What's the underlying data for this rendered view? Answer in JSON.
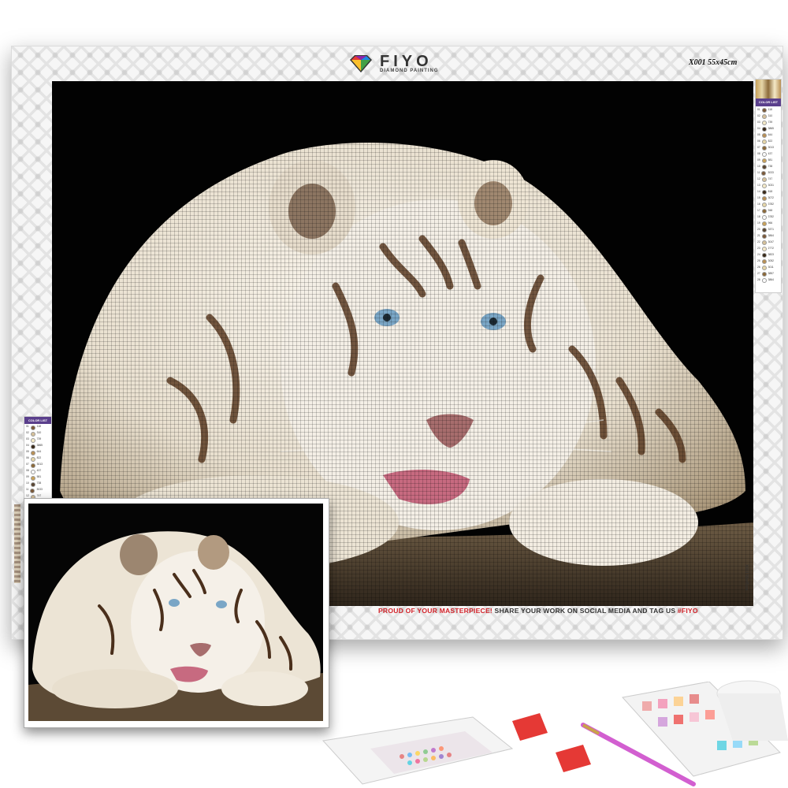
{
  "brand": {
    "name": "FIYO",
    "subtitle": "DIAMOND PAINTING"
  },
  "canvas": {
    "size_label": "X001 55x45cm",
    "side_code": "X001 55x45cm",
    "legend_title": "COLOR LIST"
  },
  "footer": {
    "highlight": "PROUD OF YOUR MASTERPIECE!",
    "message": " SHARE YOUR WORK ON SOCIAL MEDIA AND TAG US ",
    "hashtag": "#FIYO"
  },
  "legend_right_rows": [
    [
      "01",
      "118"
    ],
    [
      "02",
      "310"
    ],
    [
      "03",
      "739"
    ],
    [
      "04",
      "3865"
    ],
    [
      "05",
      "644"
    ],
    [
      "06",
      "822"
    ],
    [
      "07",
      "3013"
    ],
    [
      "08",
      "437"
    ],
    [
      "09",
      "581"
    ],
    [
      "10",
      "738"
    ],
    [
      "11",
      "3033"
    ],
    [
      "12",
      "747"
    ],
    [
      "13",
      "3031"
    ],
    [
      "14",
      "818"
    ],
    [
      "15",
      "3072"
    ],
    [
      "16",
      "3782"
    ],
    [
      "17",
      "948"
    ],
    [
      "18",
      "3782"
    ],
    [
      "19",
      "966"
    ],
    [
      "20",
      "3371"
    ],
    [
      "21",
      "3864"
    ],
    [
      "22",
      "3047"
    ],
    [
      "23",
      "2772"
    ],
    [
      "24",
      "3823"
    ],
    [
      "25",
      "3052"
    ],
    [
      "26",
      "3011"
    ],
    [
      "27",
      "3857"
    ],
    [
      "28",
      "3864"
    ]
  ],
  "legend_left_rows": [
    [
      "01",
      "118"
    ],
    [
      "02",
      "310"
    ],
    [
      "03",
      "739"
    ],
    [
      "04",
      "3865"
    ],
    [
      "05",
      "644"
    ],
    [
      "06",
      "822"
    ],
    [
      "07",
      "3013"
    ],
    [
      "08",
      "437"
    ],
    [
      "09",
      "581"
    ],
    [
      "10",
      "738"
    ],
    [
      "11",
      "3033"
    ],
    [
      "12",
      "747"
    ],
    [
      "13",
      "3031"
    ]
  ],
  "colors": {
    "accent_red": "#d2232a",
    "legend_header": "#5a3f8c",
    "background_black": "#000000"
  },
  "icons": {
    "logo": "diamond-logo-icon"
  }
}
